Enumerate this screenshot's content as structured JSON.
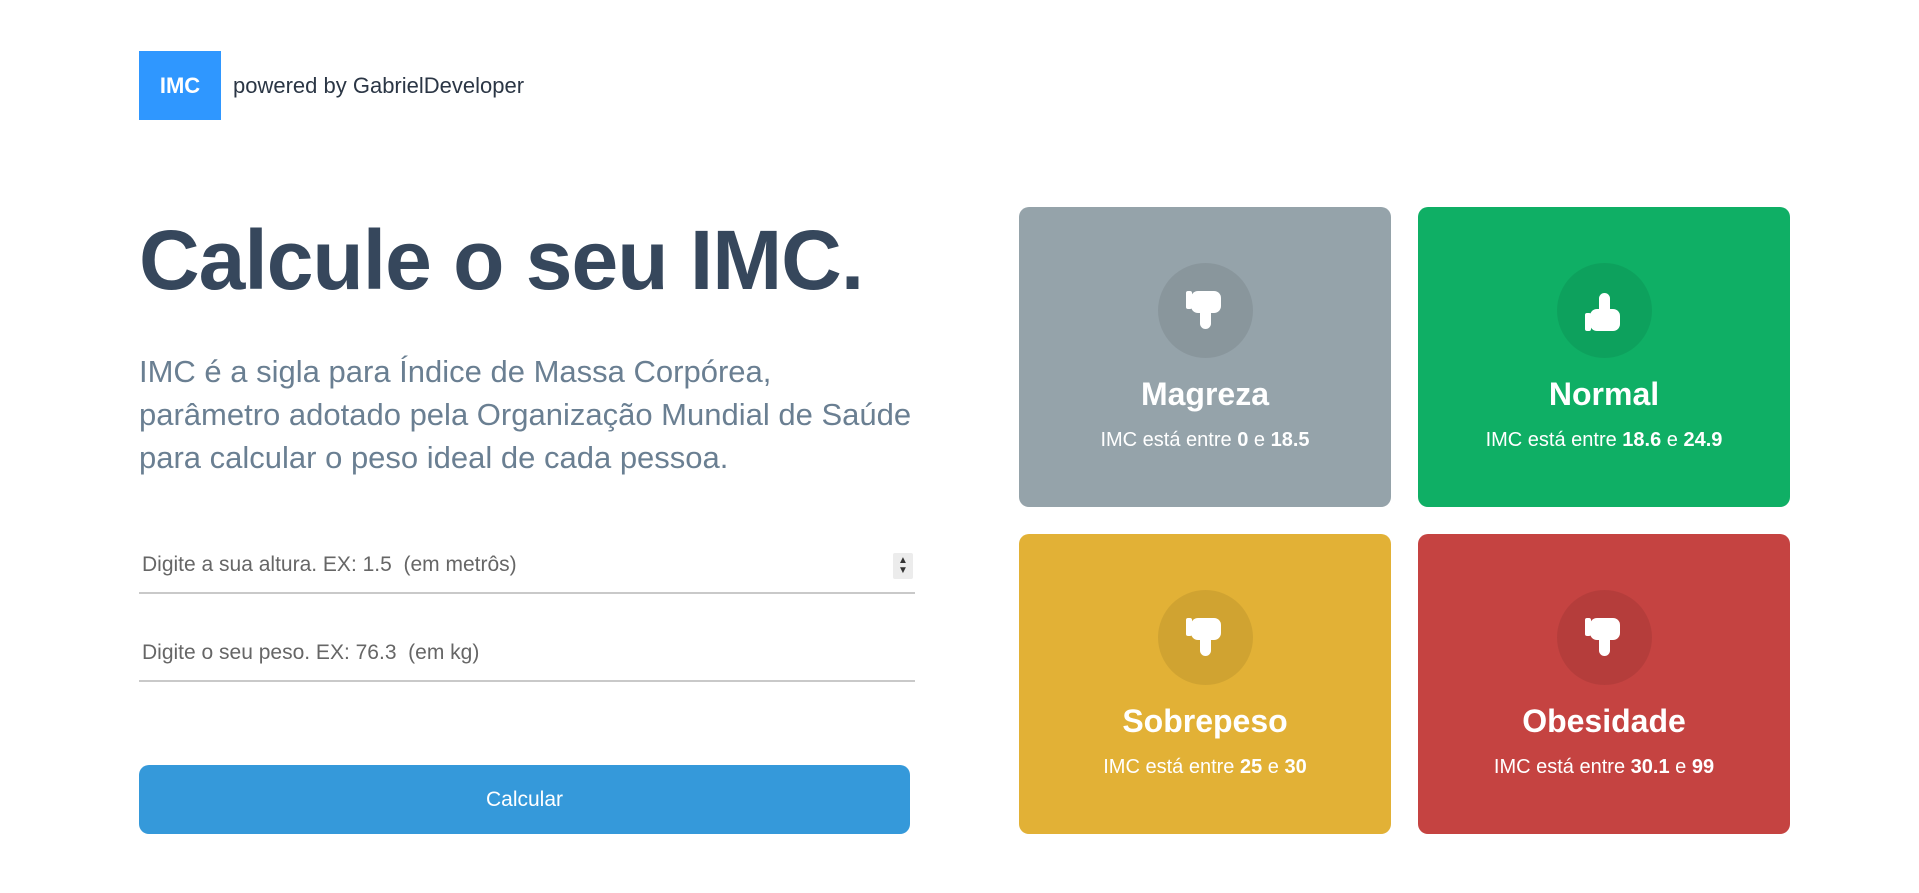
{
  "header": {
    "logo_text": "IMC",
    "powered_by": "powered by GabrielDeveloper"
  },
  "main": {
    "title": "Calcule o seu IMC.",
    "description": "IMC é a sigla para Índice de Massa Corpórea, parâmetro adotado pela Organização Mundial de Saúde para calcular o peso ideal de cada pessoa.",
    "height_placeholder": "Digite a sua altura. EX: 1.5  (em metrôs)",
    "weight_placeholder": "Digite o seu peso. EX: 76.3  (em kg)",
    "button_label": "Calcular"
  },
  "cards": [
    {
      "name": "Magreza",
      "range_prefix": "IMC está entre",
      "min": "0",
      "joiner": "e",
      "max": "18.5",
      "color": "#95a3aa",
      "icon": "thumbs-down-icon"
    },
    {
      "name": "Normal",
      "range_prefix": "IMC está entre",
      "min": "18.6",
      "joiner": "e",
      "max": "24.9",
      "color": "#0faf65",
      "icon": "thumbs-up-icon"
    },
    {
      "name": "Sobrepeso",
      "range_prefix": "IMC está entre",
      "min": "25",
      "joiner": "e",
      "max": "30",
      "color": "#e2b136",
      "icon": "thumbs-down-icon"
    },
    {
      "name": "Obesidade",
      "range_prefix": "IMC está entre",
      "min": "30.1",
      "joiner": "e",
      "max": "99",
      "color": "#c54341",
      "icon": "thumbs-down-icon"
    }
  ]
}
